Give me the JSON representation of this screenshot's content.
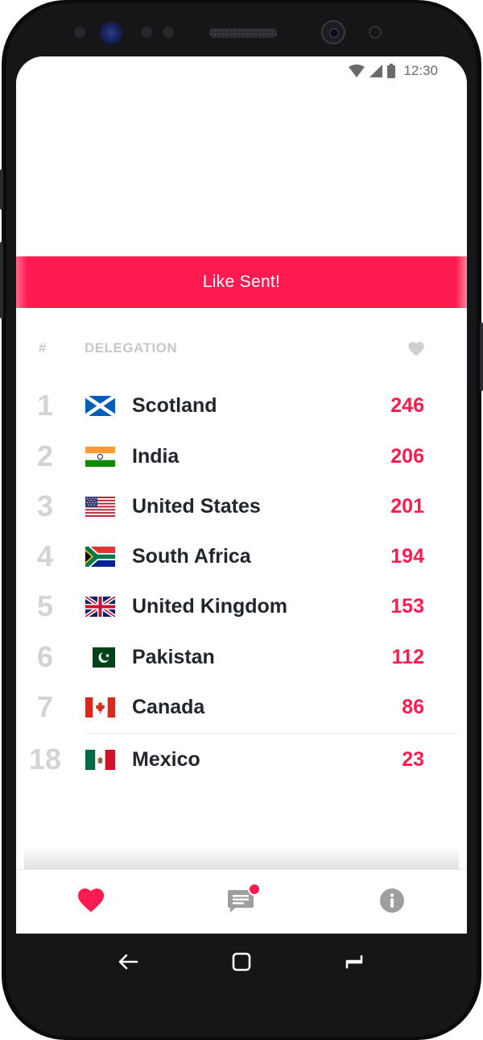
{
  "status_bar": {
    "time": "12:30"
  },
  "banner": {
    "text": "Like Sent!"
  },
  "table_header": {
    "rank": "#",
    "delegation": "DELEGATION"
  },
  "rows": [
    {
      "rank": "1",
      "name": "Scotland",
      "likes": "246",
      "flag": "scotland-flag-icon"
    },
    {
      "rank": "2",
      "name": "India",
      "likes": "206",
      "flag": "india-flag-icon"
    },
    {
      "rank": "3",
      "name": "United States",
      "likes": "201",
      "flag": "united-states-flag-icon"
    },
    {
      "rank": "4",
      "name": "South Africa",
      "likes": "194",
      "flag": "south-africa-flag-icon"
    },
    {
      "rank": "5",
      "name": "United Kingdom",
      "likes": "153",
      "flag": "united-kingdom-flag-icon"
    },
    {
      "rank": "6",
      "name": "Pakistan",
      "likes": "112",
      "flag": "pakistan-flag-icon"
    },
    {
      "rank": "7",
      "name": "Canada",
      "likes": "86",
      "flag": "canada-flag-icon"
    },
    {
      "rank": "18",
      "name": "Mexico",
      "likes": "23",
      "flag": "mexico-flag-icon"
    }
  ],
  "bottom_nav": {
    "items": [
      {
        "icon": "heart-icon",
        "active": true
      },
      {
        "icon": "chat-icon",
        "badge": true
      },
      {
        "icon": "info-icon",
        "active": false
      }
    ]
  },
  "colors": {
    "accent": "#ff1a4f",
    "text_dark": "#21262d",
    "rank_gray": "#d4d4d4",
    "header_gray": "#c8c8c8",
    "icon_gray": "#9e9e9e"
  }
}
